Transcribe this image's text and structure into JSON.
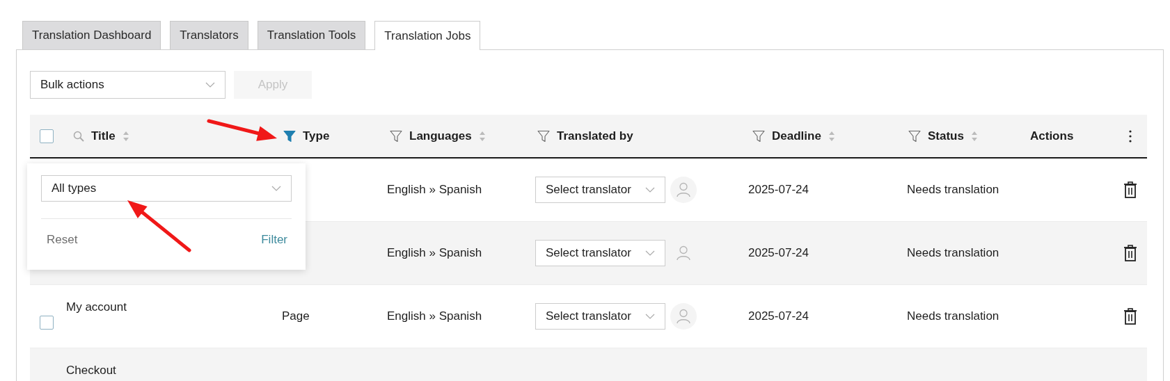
{
  "tabs": [
    {
      "label": "Translation Dashboard",
      "selected": false
    },
    {
      "label": "Translators",
      "selected": false
    },
    {
      "label": "Translation Tools",
      "selected": false
    },
    {
      "label": "Translation Jobs",
      "selected": true
    }
  ],
  "bulk_actions": {
    "value": "Bulk actions"
  },
  "apply_button": {
    "label": "Apply",
    "disabled": true
  },
  "table": {
    "select_all": {
      "checked": false
    },
    "columns": [
      {
        "label": "Title",
        "kind": "search",
        "sortable": true
      },
      {
        "label": "Type",
        "kind": "filter",
        "filter_active": true,
        "sortable": false
      },
      {
        "label": "Languages",
        "kind": "filter",
        "filter_active": false,
        "sortable": true
      },
      {
        "label": "Translated by",
        "kind": "filter",
        "filter_active": false,
        "sortable": false
      },
      {
        "label": "Deadline",
        "kind": "filter",
        "filter_active": false,
        "sortable": true
      },
      {
        "label": "Status",
        "kind": "filter",
        "filter_active": false,
        "sortable": true
      },
      {
        "label": "Actions",
        "kind": "plain",
        "sortable": false
      }
    ],
    "rows": [
      {
        "languages": "English » Spanish",
        "translator_placeholder": "Select translator",
        "deadline": "2025-07-24",
        "status": "Needs translation"
      },
      {
        "languages": "English » Spanish",
        "translator_placeholder": "Select translator",
        "deadline": "2025-07-24",
        "status": "Needs translation"
      },
      {
        "title": "My account",
        "checked": false,
        "type": "Page",
        "languages": "English » Spanish",
        "translator_placeholder": "Select translator",
        "deadline": "2025-07-24",
        "status": "Needs translation"
      },
      {
        "title": "Checkout"
      }
    ]
  },
  "filter_popup": {
    "type_select": {
      "value": "All types"
    },
    "reset_button": "Reset",
    "filter_button": "Filter"
  }
}
